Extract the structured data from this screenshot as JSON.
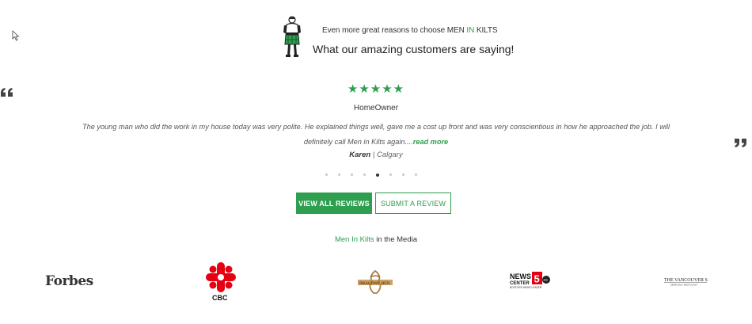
{
  "header": {
    "tagline_prefix": "Even more great reasons to choose MEN ",
    "tagline_in": "IN",
    "tagline_suffix": " KILTS",
    "heading": "What our amazing customers are saying!"
  },
  "review": {
    "rating_stars": "★★★★★",
    "rating": 5,
    "reviewer_type": "HomeOwner",
    "text": "The young man who did the work in my house today was very polite. He explained things well, gave me a cost up front and was very conscientious in how he approached the job. I will definitely call Men in Kilts again....",
    "read_more": "read more",
    "author_name": "Karen",
    "author_sep": " | ",
    "author_city": "Calgary"
  },
  "carousel": {
    "dot_count": 8,
    "active_index": 4
  },
  "buttons": {
    "view_all": "VIEW ALL REVIEWS",
    "submit": "SUBMIT A REVIEW"
  },
  "media": {
    "title_green": "Men In Kilts",
    "title_rest": " in the Media",
    "logos": {
      "forbes": "Forbes",
      "cbc": "CBC",
      "dragons_den": "DRAGONS' DEN",
      "news_center": "NEWS CENTER 5",
      "news_sub": "BOSTON'S NEWS LEADER",
      "vancouver_sun": "THE VANCOUVER SUN",
      "vancouver_sub": "SERIOUSLY WESTCOAST"
    }
  },
  "colors": {
    "brand_green": "#2e9e4f",
    "text_dark": "#333333",
    "cbc_red": "#e60012"
  },
  "icons": [
    "cursor-arrow-icon",
    "kilt-man-logo-icon",
    "quote-open-icon",
    "quote-close-icon",
    "star-icon"
  ]
}
